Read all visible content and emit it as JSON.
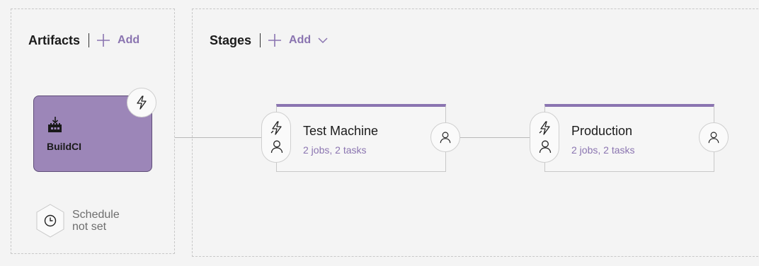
{
  "artifacts": {
    "title": "Artifacts",
    "add_label": "Add",
    "card": {
      "name": "BuildCI",
      "color": "#9c86b8"
    },
    "schedule": {
      "line1": "Schedule",
      "line2": "not set"
    }
  },
  "stages": {
    "title": "Stages",
    "add_label": "Add",
    "items": [
      {
        "name": "Test Machine",
        "summary": "2 jobs, 2 tasks"
      },
      {
        "name": "Production",
        "summary": "2 jobs, 2 tasks"
      }
    ]
  },
  "colors": {
    "accent": "#8a74b0",
    "artifact_fill": "#9c86b8",
    "background": "#f4f4f4"
  },
  "icons": [
    "plus-icon",
    "chevron-down-icon",
    "build-icon",
    "lightning-icon",
    "person-icon",
    "clock-icon"
  ]
}
